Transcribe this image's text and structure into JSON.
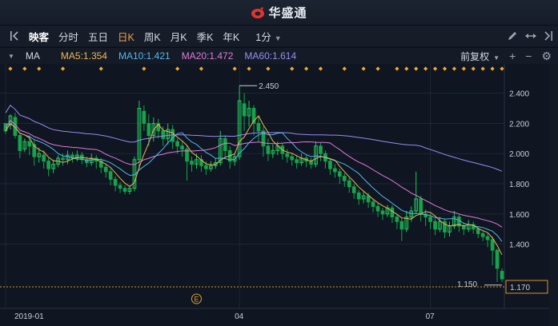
{
  "app": {
    "title": "华盛通"
  },
  "toolbar": {
    "items": [
      {
        "label": "映客"
      },
      {
        "label": "分时"
      },
      {
        "label": "五日"
      },
      {
        "label": "日K"
      },
      {
        "label": "周K"
      },
      {
        "label": "月K"
      },
      {
        "label": "季K"
      },
      {
        "label": "年K"
      },
      {
        "label": "1分"
      }
    ],
    "active_index": 3
  },
  "indicators": {
    "name": "MA",
    "ma5": "MA5:1.354",
    "ma10": "MA10:1.421",
    "ma20": "MA20:1.472",
    "ma60": "MA60:1.614",
    "adjust": "前复权"
  },
  "colors": {
    "up": "#22c55e",
    "down": "#22c55e",
    "ma5": "#f0b452",
    "ma10": "#52b7ef",
    "ma20": "#e07ad8",
    "ma60": "#9a8cf2",
    "marker": "#f0a830"
  },
  "chart_data": {
    "type": "candlestick",
    "ylim": [
      1.08,
      2.52
    ],
    "y_ticks": [
      "2.400",
      "2.200",
      "2.000",
      "1.800",
      "1.600",
      "1.400"
    ],
    "x_ticks": [
      "2019-01",
      "04",
      "07"
    ],
    "high_label": "2.450",
    "low_label": "1.150",
    "last_price": "1.170",
    "event_marker": "E",
    "candles": [
      [
        2.2,
        2.15,
        2.18,
        2.13
      ],
      [
        2.19,
        2.25,
        2.16,
        2.26
      ],
      [
        2.24,
        2.12,
        2.1,
        2.27
      ],
      [
        2.12,
        2.02,
        1.97,
        2.14
      ],
      [
        2.03,
        2.08,
        2.01,
        2.1
      ],
      [
        2.08,
        2.05,
        1.99,
        2.12
      ],
      [
        2.06,
        1.98,
        1.92,
        2.09
      ],
      [
        1.98,
        2.0,
        1.94,
        2.04
      ],
      [
        1.99,
        1.95,
        1.9,
        2.02
      ],
      [
        1.95,
        1.9,
        1.85,
        1.97
      ],
      [
        1.9,
        1.93,
        1.87,
        1.96
      ],
      [
        1.93,
        1.97,
        1.91,
        1.99
      ],
      [
        1.97,
        1.96,
        1.92,
        2.0
      ],
      [
        1.96,
        1.99,
        1.93,
        2.02
      ],
      [
        1.99,
        1.97,
        1.94,
        2.01
      ],
      [
        1.97,
        1.99,
        1.95,
        2.02
      ],
      [
        1.99,
        1.96,
        1.93,
        2.01
      ],
      [
        1.96,
        1.94,
        1.91,
        1.98
      ],
      [
        1.94,
        1.97,
        1.92,
        2.0
      ],
      [
        1.97,
        1.95,
        1.9,
        1.99
      ],
      [
        1.95,
        1.91,
        1.87,
        1.97
      ],
      [
        1.91,
        1.88,
        1.84,
        1.93
      ],
      [
        1.88,
        1.83,
        1.79,
        1.9
      ],
      [
        1.83,
        1.79,
        1.75,
        1.85
      ],
      [
        1.79,
        1.77,
        1.74,
        1.81
      ],
      [
        1.77,
        1.75,
        1.73,
        1.79
      ],
      [
        1.75,
        1.77,
        1.73,
        1.79
      ],
      [
        1.77,
        1.96,
        1.75,
        1.98
      ],
      [
        1.96,
        2.3,
        1.9,
        2.35
      ],
      [
        2.28,
        2.2,
        2.15,
        2.32
      ],
      [
        2.2,
        2.12,
        2.05,
        2.26
      ],
      [
        2.12,
        2.2,
        2.08,
        2.24
      ],
      [
        2.2,
        2.15,
        2.1,
        2.23
      ],
      [
        2.15,
        2.1,
        2.05,
        2.18
      ],
      [
        2.1,
        2.16,
        2.06,
        2.2
      ],
      [
        2.16,
        2.08,
        2.03,
        2.19
      ],
      [
        2.08,
        2.05,
        2.0,
        2.1
      ],
      [
        2.05,
        2.03,
        1.98,
        2.08
      ],
      [
        2.03,
        1.95,
        1.82,
        2.05
      ],
      [
        1.95,
        1.93,
        1.88,
        1.98
      ],
      [
        1.93,
        1.96,
        1.9,
        2.0
      ],
      [
        1.96,
        1.92,
        1.88,
        1.99
      ],
      [
        1.92,
        1.9,
        1.86,
        1.95
      ],
      [
        1.9,
        1.92,
        1.88,
        1.95
      ],
      [
        1.92,
        1.94,
        1.9,
        1.97
      ],
      [
        1.94,
        2.1,
        1.92,
        2.15
      ],
      [
        2.1,
        2.02,
        1.97,
        2.12
      ],
      [
        2.02,
        1.95,
        1.9,
        2.05
      ],
      [
        1.95,
        1.98,
        1.92,
        2.0
      ],
      [
        1.98,
        2.35,
        1.96,
        2.45
      ],
      [
        2.33,
        2.25,
        2.15,
        2.4
      ],
      [
        2.25,
        2.3,
        2.18,
        2.35
      ],
      [
        2.3,
        2.2,
        2.12,
        2.32
      ],
      [
        2.2,
        2.15,
        2.08,
        2.25
      ],
      [
        2.15,
        2.05,
        1.98,
        2.18
      ],
      [
        2.05,
        2.0,
        1.95,
        2.1
      ],
      [
        2.0,
        2.02,
        1.97,
        2.06
      ],
      [
        2.02,
        2.05,
        1.99,
        2.08
      ],
      [
        2.05,
        2.0,
        1.96,
        2.07
      ],
      [
        2.0,
        1.98,
        1.94,
        2.03
      ],
      [
        1.98,
        1.96,
        1.92,
        2.0
      ],
      [
        1.96,
        1.94,
        1.9,
        1.99
      ],
      [
        1.94,
        1.97,
        1.92,
        2.0
      ],
      [
        1.97,
        1.95,
        1.91,
        1.99
      ],
      [
        1.95,
        1.93,
        1.9,
        1.97
      ],
      [
        1.93,
        2.05,
        1.91,
        2.08
      ],
      [
        2.05,
        2.0,
        1.95,
        2.07
      ],
      [
        2.0,
        1.95,
        1.9,
        2.02
      ],
      [
        1.95,
        1.9,
        1.86,
        1.97
      ],
      [
        1.9,
        1.88,
        1.84,
        1.93
      ],
      [
        1.88,
        1.85,
        1.8,
        1.9
      ],
      [
        1.85,
        1.82,
        1.78,
        1.87
      ],
      [
        1.82,
        1.78,
        1.74,
        1.84
      ],
      [
        1.78,
        1.74,
        1.7,
        1.8
      ],
      [
        1.74,
        1.7,
        1.66,
        1.76
      ],
      [
        1.7,
        1.72,
        1.67,
        1.75
      ],
      [
        1.72,
        1.68,
        1.64,
        1.74
      ],
      [
        1.68,
        1.65,
        1.61,
        1.7
      ],
      [
        1.65,
        1.62,
        1.58,
        1.67
      ],
      [
        1.62,
        1.6,
        1.56,
        1.64
      ],
      [
        1.6,
        1.64,
        1.58,
        1.66
      ],
      [
        1.64,
        1.58,
        1.54,
        1.66
      ],
      [
        1.58,
        1.55,
        1.5,
        1.6
      ],
      [
        1.55,
        1.5,
        1.42,
        1.57
      ],
      [
        1.5,
        1.58,
        1.48,
        1.62
      ],
      [
        1.58,
        1.62,
        1.55,
        1.65
      ],
      [
        1.62,
        1.7,
        1.6,
        1.88
      ],
      [
        1.7,
        1.6,
        1.55,
        1.72
      ],
      [
        1.6,
        1.58,
        1.52,
        1.63
      ],
      [
        1.58,
        1.55,
        1.5,
        1.6
      ],
      [
        1.55,
        1.5,
        1.46,
        1.57
      ],
      [
        1.5,
        1.55,
        1.48,
        1.58
      ],
      [
        1.55,
        1.48,
        1.44,
        1.57
      ],
      [
        1.48,
        1.52,
        1.45,
        1.55
      ],
      [
        1.52,
        1.58,
        1.5,
        1.62
      ],
      [
        1.58,
        1.52,
        1.48,
        1.6
      ],
      [
        1.52,
        1.5,
        1.46,
        1.54
      ],
      [
        1.5,
        1.53,
        1.48,
        1.56
      ],
      [
        1.53,
        1.5,
        1.47,
        1.55
      ],
      [
        1.5,
        1.47,
        1.44,
        1.52
      ],
      [
        1.47,
        1.45,
        1.42,
        1.49
      ],
      [
        1.45,
        1.43,
        1.38,
        1.47
      ],
      [
        1.43,
        1.36,
        1.26,
        1.45
      ],
      [
        1.36,
        1.24,
        1.15,
        1.37
      ],
      [
        1.22,
        1.17,
        1.15,
        1.24
      ]
    ]
  }
}
